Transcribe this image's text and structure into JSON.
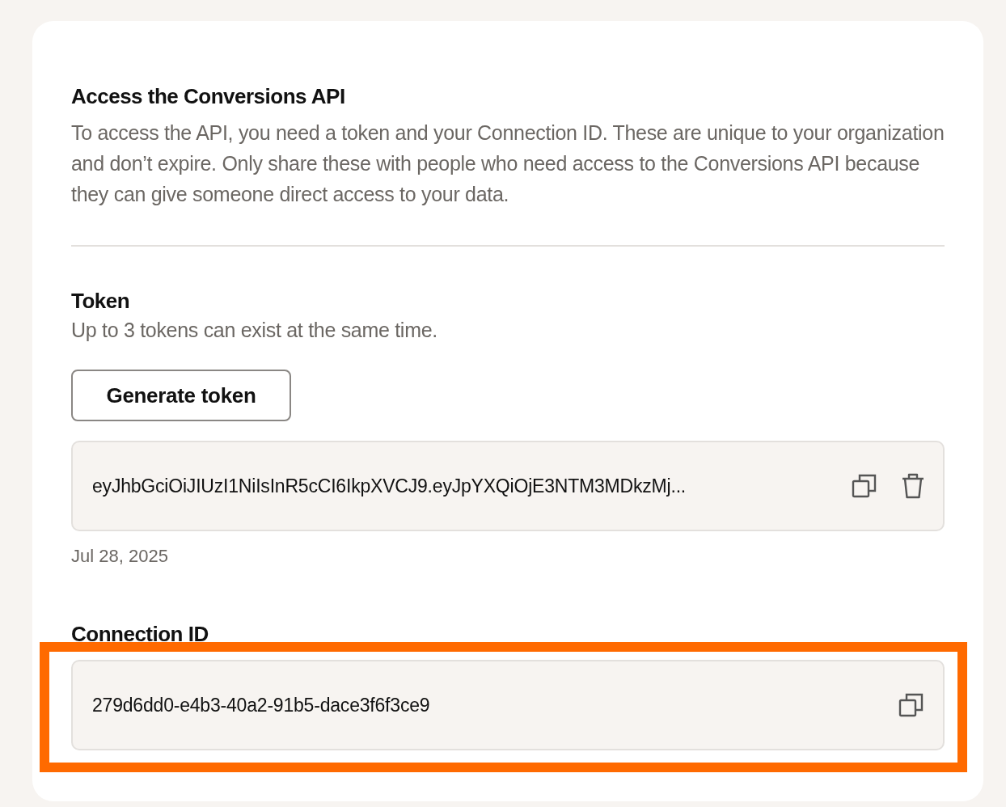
{
  "intro": {
    "title": "Access the Conversions API",
    "description": "To access the API, you need a token and your Connection ID. These are unique to your organization and don’t expire. Only share these with people who need access to the Conversions API because they can give someone direct access to your data."
  },
  "token": {
    "title": "Token",
    "hint": "Up to 3 tokens can exist at the same time.",
    "button": "Generate token",
    "tokens": [
      {
        "value": "eyJhbGciOiJIUzI1NiIsInR5cCI6IkpXVCJ9.eyJpYXQiOjE3NTM3MDkzMj...",
        "date": "Jul 28, 2025"
      }
    ]
  },
  "connection": {
    "title": "Connection ID",
    "value": "279d6dd0-e4b3-40a2-91b5-dace3f6f3ce9",
    "highlighted": true
  }
}
